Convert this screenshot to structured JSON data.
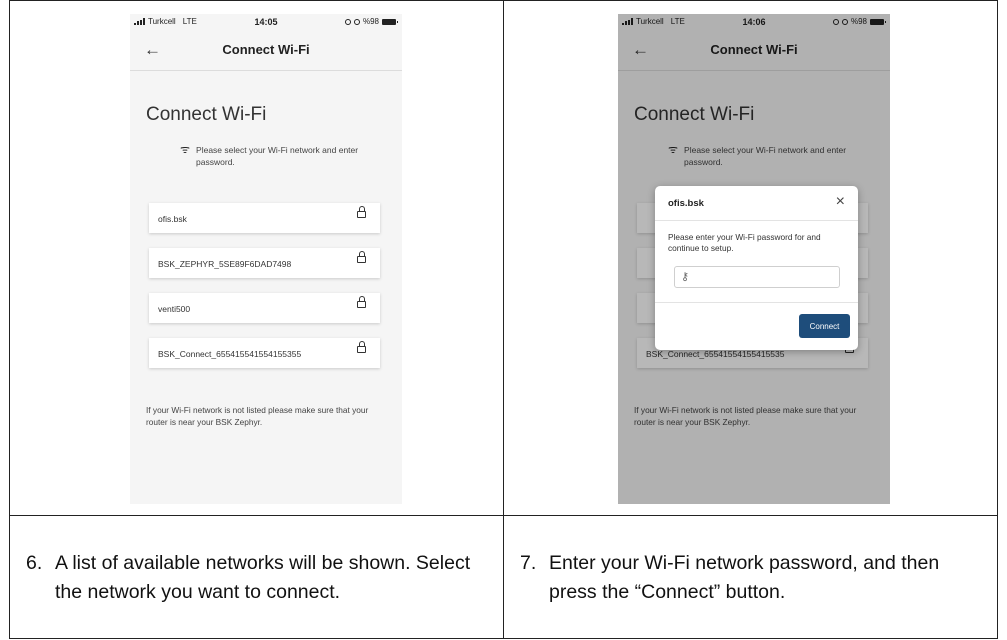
{
  "left_screen": {
    "status": {
      "carrier": "Turkcell",
      "network": "LTE",
      "time": "14:05",
      "battery": "%98"
    },
    "nav_title": "Connect Wi-Fi",
    "heading": "Connect Wi-Fi",
    "info": "Please select your Wi-Fi network and enter password.",
    "networks": [
      {
        "name": "ofis.bsk"
      },
      {
        "name": "BSK_ZEPHYR_5SE89F6DAD7498"
      },
      {
        "name": "venti500"
      },
      {
        "name": "BSK_Connect_655415541554155355"
      }
    ],
    "footer": "If your Wi-Fi network is not listed please make sure that your router is near your BSK Zephyr."
  },
  "right_screen": {
    "status": {
      "carrier": "Turkcell",
      "network": "LTE",
      "time": "14:06",
      "battery": "%98"
    },
    "nav_title": "Connect Wi-Fi",
    "heading": "Connect Wi-Fi",
    "info": "Please select your Wi-Fi network and enter password.",
    "last_network": "BSK_Connect_65541554155415535",
    "footer": "If your Wi-Fi network is not listed please make sure that your router is near your BSK Zephyr.",
    "dialog": {
      "title": "ofis.bsk",
      "close_icon": "×",
      "message": "Please enter your Wi-Fi password for and continue to setup.",
      "password_value": "",
      "connect_label": "Connect"
    }
  },
  "steps": [
    {
      "number": "6.",
      "text": "A list of available networks will be shown. Select the network you want to connect."
    },
    {
      "number": "7.",
      "text": "Enter your Wi-Fi network password, and then press the “Connect” button."
    }
  ],
  "colors": {
    "connect_button": "#1e4d7b",
    "screen_background": "#f5f5f5"
  }
}
